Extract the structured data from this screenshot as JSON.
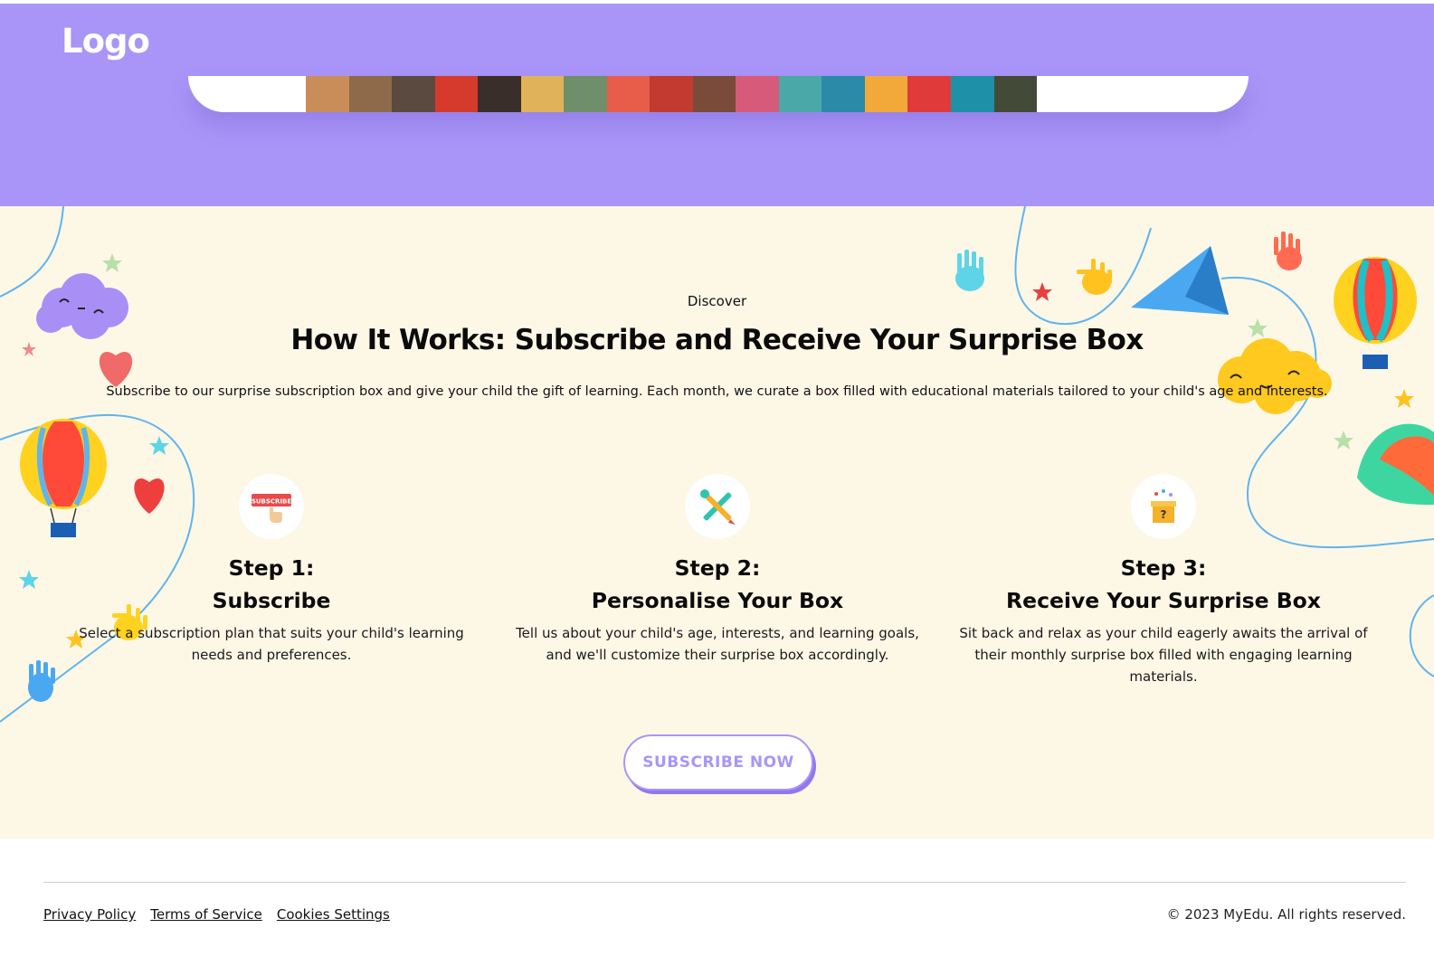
{
  "header": {
    "logo": "Logo"
  },
  "colors": {
    "hero_bg": "#a995f8",
    "section_bg": "#fdf7e6",
    "accent": "#a995f8"
  },
  "how_it_works": {
    "eyebrow": "Discover",
    "title": "How It Works: Subscribe and Receive Your Surprise Box",
    "intro": "Subscribe to our surprise subscription box and give your child the gift of learning. Each month, we curate a box filled with educational materials tailored to your child's age and interests.",
    "steps": [
      {
        "icon": "subscribe-icon",
        "icon_text": "SUBSCRIBE",
        "step_label": "Step 1:",
        "title": "Subscribe",
        "description": "Select a subscription plan that suits your child's learning needs and preferences."
      },
      {
        "icon": "tools-icon",
        "step_label": "Step 2:",
        "title": "Personalise Your Box",
        "description": "Tell us about your child's age, interests, and learning goals, and we'll customize their surprise box accordingly."
      },
      {
        "icon": "gift-box-icon",
        "step_label": "Step 3:",
        "title": "Receive Your Surprise Box",
        "description": "Sit back and relax as your child eagerly awaits the arrival of their monthly surprise box filled with engaging learning materials."
      }
    ],
    "cta_label": "SUBSCRIBE NOW"
  },
  "footer": {
    "links": [
      "Privacy Policy",
      "Terms of Service",
      "Cookies Settings"
    ],
    "copyright": "© 2023 MyEdu. All rights reserved."
  }
}
